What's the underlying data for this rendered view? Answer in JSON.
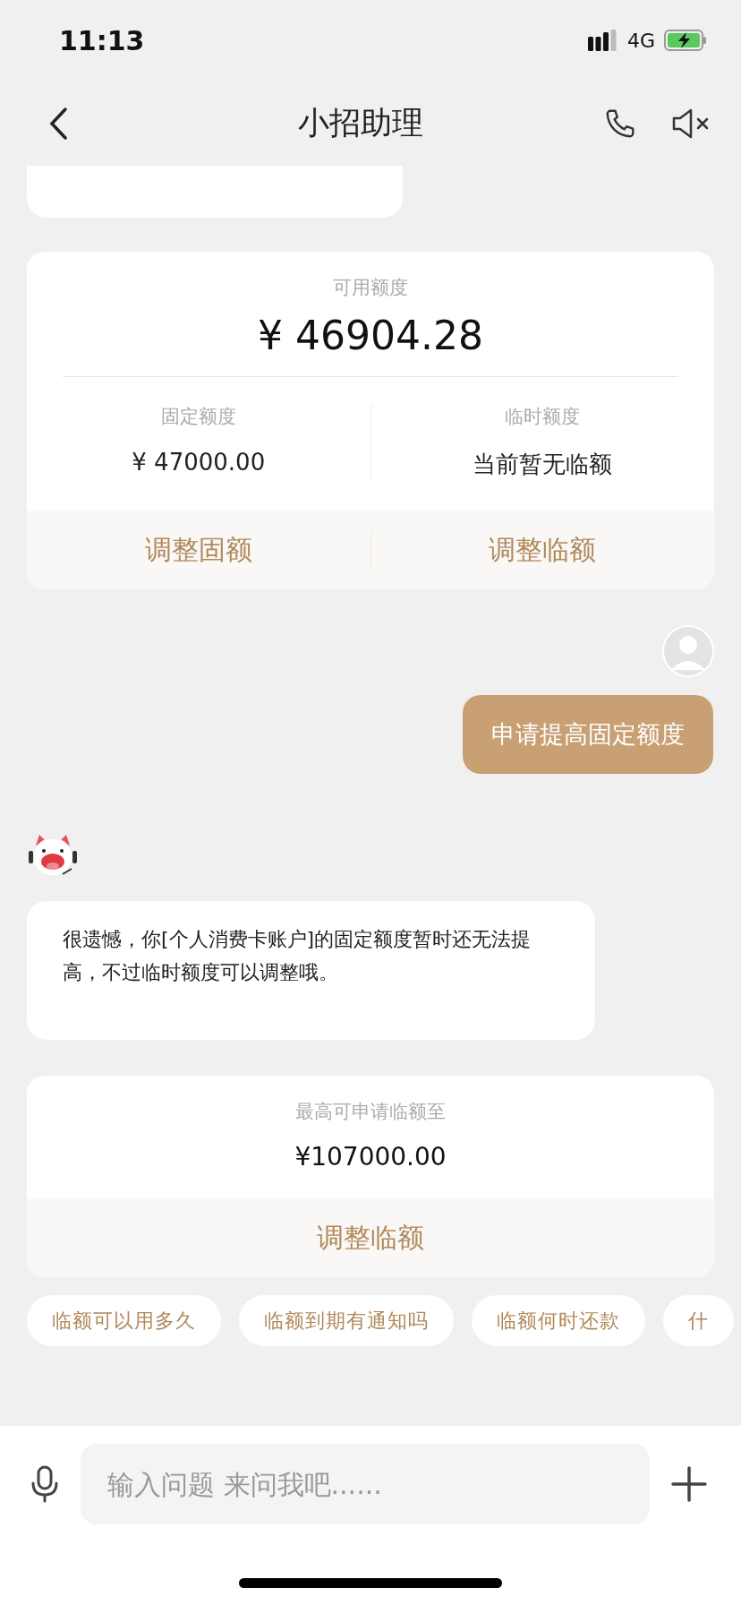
{
  "status_bar": {
    "time": "11:13",
    "network": "4G"
  },
  "nav": {
    "title": "小招助理"
  },
  "messages": [
    {
      "kind": "partial"
    },
    {
      "kind": "credit_card",
      "label": "可用额度",
      "amount": "¥ 46904.28",
      "columns": [
        {
          "label": "固定额度",
          "value": "¥ 47000.00"
        },
        {
          "label": "临时额度",
          "value": "当前暂无临额"
        }
      ],
      "actions": [
        "调整固额",
        "调整临额"
      ]
    },
    {
      "kind": "user",
      "text": "申请提高固定额度"
    },
    {
      "kind": "bot",
      "text": "很遗憾，你[个人消费卡账户]的固定额度暂时还无法提高，不过临时额度可以调整哦。"
    },
    {
      "kind": "temp_card",
      "label": "最高可申请临额至",
      "amount": "¥107000.00",
      "actions": [
        "调整临额"
      ]
    }
  ],
  "suggestions": [
    "临额可以用多久",
    "临额到期有通知吗",
    "临额何时还款",
    "什"
  ],
  "input": {
    "placeholder": "输入问题 来问我吧......"
  }
}
